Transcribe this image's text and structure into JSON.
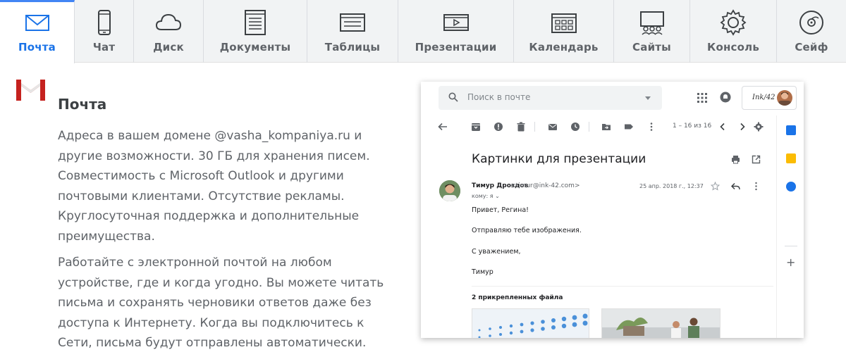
{
  "tabs": [
    {
      "label": "Почта",
      "icon": "mail-icon",
      "active": true
    },
    {
      "label": "Чат",
      "icon": "phone-icon",
      "active": false
    },
    {
      "label": "Диск",
      "icon": "cloud-icon",
      "active": false
    },
    {
      "label": "Документы",
      "icon": "document-icon",
      "active": false
    },
    {
      "label": "Таблицы",
      "icon": "spreadsheet-icon",
      "active": false
    },
    {
      "label": "Презентации",
      "icon": "presentation-icon",
      "active": false
    },
    {
      "label": "Календарь",
      "icon": "calendar-icon",
      "active": false
    },
    {
      "label": "Сайты",
      "icon": "sites-icon",
      "active": false
    },
    {
      "label": "Консоль",
      "icon": "gear-icon",
      "active": false
    },
    {
      "label": "Сейф",
      "icon": "vault-icon",
      "active": false
    }
  ],
  "section": {
    "title": "Почта",
    "paragraph1": "Адреса в вашем домене @vasha_kompaniya.ru и другие возможности. 30 ГБ для хранения писем. Совместимость с Microsoft Outlook и другими почтовыми клиентами. Отсутствие рекламы. Круглосуточная поддержка и дополнительные преимущества.",
    "paragraph2": "Работайте с электронной почтой на любом устройстве, где и когда угодно. Вы можете читать письма и сохранять черновики ответов даже без доступа к Интернету. Когда вы подключитесь к Сети, письма будут отправлены автоматически."
  },
  "mail_client": {
    "search_placeholder": "Поиск в почте",
    "account_brand": "Ink/42",
    "pager": "1 – 16 из 16",
    "subject": "Картинки для презентации",
    "sender_name": "Тимур Дроздов",
    "sender_email": "<timur@ink-42.com>",
    "recipient": "кому: я ⌄",
    "date": "25 апр. 2018 г., 12:37",
    "body_lines": [
      "Привет, Регина!",
      "Отправляю тебе изображения.",
      "С уважением,",
      "Тимур"
    ],
    "attachments_title": "2 прикрепленных файла"
  },
  "colors": {
    "accent": "#4285f4",
    "active_label": "#1a73e8",
    "gmail_red": "#d93025",
    "text_secondary": "#5f6368"
  }
}
